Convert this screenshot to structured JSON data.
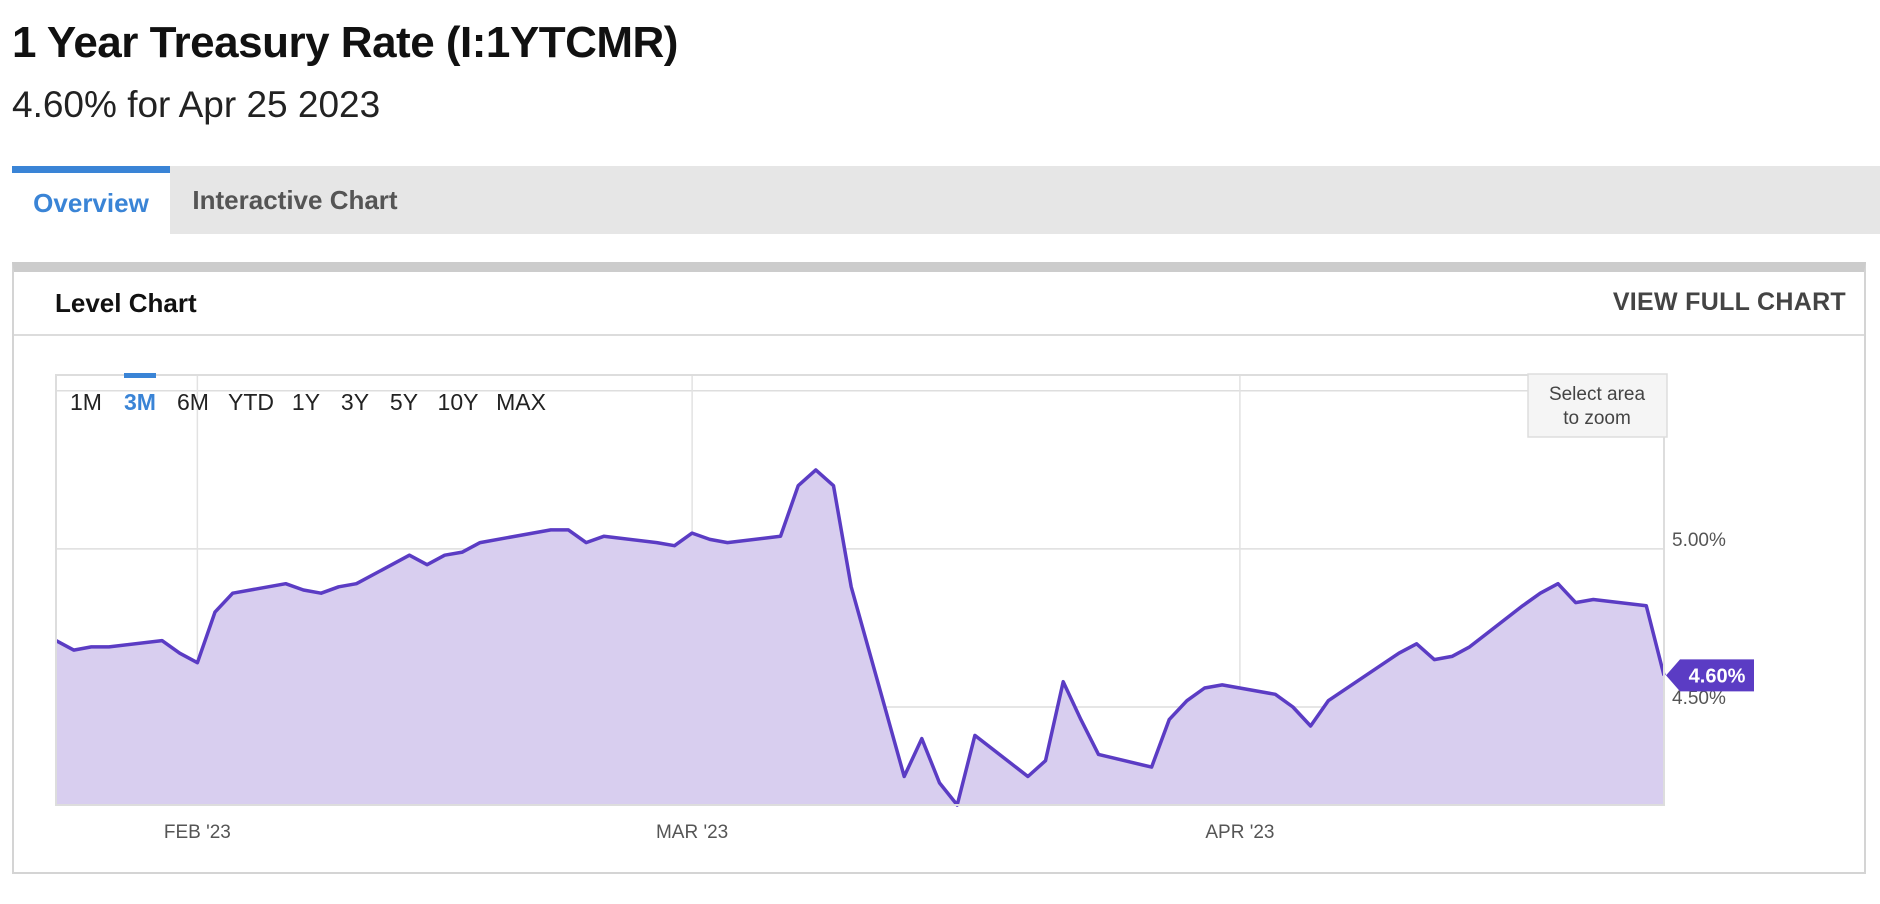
{
  "page": {
    "title": "1 Year Treasury Rate (I:1YTCMR)",
    "subtitle": "4.60% for Apr 25 2023"
  },
  "tabs": [
    {
      "label": "Overview",
      "active": true
    },
    {
      "label": "Interactive Chart",
      "active": false
    }
  ],
  "panel": {
    "title": "Level Chart",
    "view_full_label": "VIEW FULL CHART"
  },
  "range_selector": {
    "options": [
      "1M",
      "3M",
      "6M",
      "YTD",
      "1Y",
      "3Y",
      "5Y",
      "10Y",
      "MAX"
    ],
    "selected": "3M"
  },
  "zoom_hint": {
    "line1": "Select area",
    "line2": "to zoom"
  },
  "colors": {
    "accent": "#3a84d6",
    "series_line": "#5b3cc4",
    "series_fill": "#d8ceef",
    "current_badge": "#5b3cc4"
  },
  "chart_data": {
    "type": "area",
    "title": "",
    "xlabel": "",
    "ylabel": "",
    "x_ticks": [
      "FEB '23",
      "MAR '23",
      "APR '23"
    ],
    "y_ticks": [
      "4.50%",
      "5.00%"
    ],
    "y_tick_values": [
      4.5,
      5.0
    ],
    "ylim": [
      4.19,
      5.55
    ],
    "xlim": [
      "2023-01-24",
      "2023-04-25"
    ],
    "grid": true,
    "current_value_label": "4.60%",
    "series": [
      {
        "x": [
          "2023-01-24",
          "2023-01-25",
          "2023-01-26",
          "2023-01-27",
          "2023-01-30",
          "2023-01-31",
          "2023-02-01",
          "2023-02-02",
          "2023-02-03",
          "2023-02-06",
          "2023-02-07",
          "2023-02-08",
          "2023-02-09",
          "2023-02-10",
          "2023-02-13",
          "2023-02-14",
          "2023-02-15",
          "2023-02-16",
          "2023-02-17",
          "2023-02-21",
          "2023-02-22",
          "2023-02-23",
          "2023-02-24",
          "2023-02-27",
          "2023-02-28",
          "2023-03-01",
          "2023-03-02",
          "2023-03-03",
          "2023-03-06",
          "2023-03-07",
          "2023-03-08",
          "2023-03-09",
          "2023-03-10",
          "2023-03-13",
          "2023-03-14",
          "2023-03-15",
          "2023-03-16",
          "2023-03-17",
          "2023-03-20",
          "2023-03-21",
          "2023-03-22",
          "2023-03-23",
          "2023-03-24",
          "2023-03-27",
          "2023-03-28",
          "2023-03-29",
          "2023-03-30",
          "2023-03-31",
          "2023-04-03",
          "2023-04-04",
          "2023-04-05",
          "2023-04-06",
          "2023-04-10",
          "2023-04-11",
          "2023-04-12",
          "2023-04-13",
          "2023-04-14",
          "2023-04-17",
          "2023-04-18",
          "2023-04-19",
          "2023-04-20",
          "2023-04-21",
          "2023-04-24",
          "2023-04-25"
        ],
        "values": [
          4.71,
          4.68,
          4.69,
          4.69,
          4.71,
          4.67,
          4.64,
          4.8,
          4.86,
          4.89,
          4.87,
          4.86,
          4.88,
          4.89,
          4.98,
          4.95,
          4.98,
          4.99,
          5.02,
          5.06,
          5.06,
          5.02,
          5.04,
          5.02,
          5.01,
          5.05,
          5.03,
          5.02,
          5.04,
          5.2,
          5.25,
          5.2,
          4.88,
          4.28,
          4.4,
          4.26,
          4.19,
          4.41,
          4.28,
          4.33,
          4.58,
          4.46,
          4.35,
          4.31,
          4.46,
          4.52,
          4.56,
          4.57,
          4.54,
          4.5,
          4.44,
          4.52,
          4.67,
          4.7,
          4.65,
          4.66,
          4.69,
          4.82,
          4.86,
          4.89,
          4.83,
          4.84,
          4.82,
          4.6
        ]
      }
    ]
  }
}
